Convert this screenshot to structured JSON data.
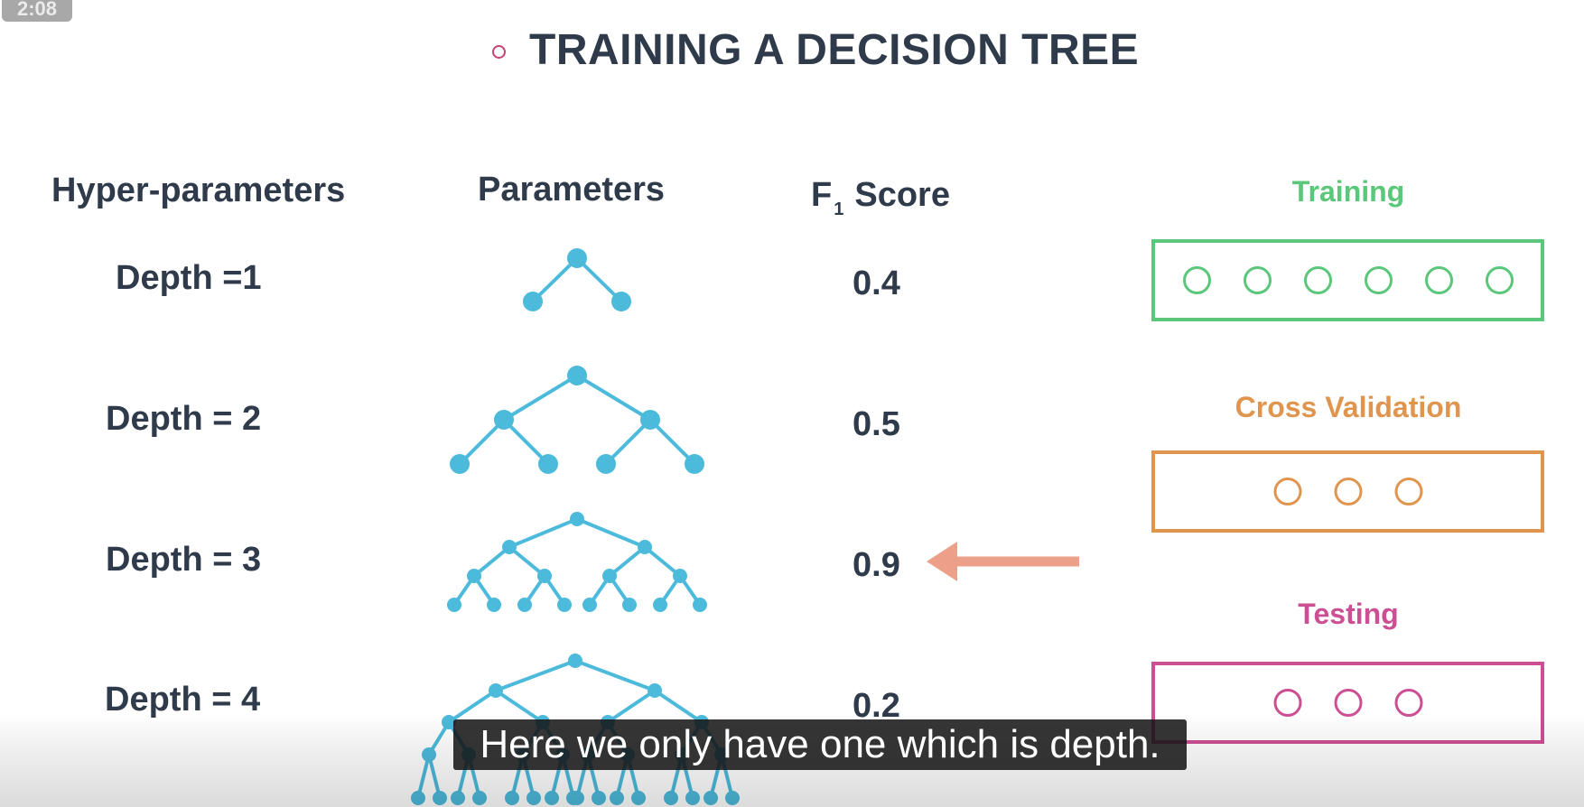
{
  "video": {
    "timestamp": "2:08"
  },
  "slide": {
    "title": "TRAINING A DECISION TREE",
    "headers": {
      "hyper_parameters": "Hyper-parameters",
      "parameters": "Parameters",
      "score_main": "F",
      "score_sub": "1",
      "score_tail": "Score"
    },
    "rows": [
      {
        "depth_label": "Depth =1",
        "score": "0.4"
      },
      {
        "depth_label": "Depth = 2",
        "score": "0.5"
      },
      {
        "depth_label": "Depth = 3",
        "score": "0.9"
      },
      {
        "depth_label": "Depth = 4",
        "score": "0.2"
      }
    ],
    "best_row_indicator": "arrow pointing to 0.9",
    "data_split": [
      {
        "label": "Training",
        "color": "#5ac77a",
        "points": 6
      },
      {
        "label": "Cross Validation",
        "color": "#e0954f",
        "points": 3
      },
      {
        "label": "Testing",
        "color": "#cc4f93",
        "points": 3
      }
    ],
    "colors": {
      "tree": "#4cbadb",
      "arrow": "#eca08a",
      "text": "#2f3a4a",
      "bullet": "#c9436e"
    }
  },
  "caption": {
    "text": "Here we only have one which is depth."
  }
}
